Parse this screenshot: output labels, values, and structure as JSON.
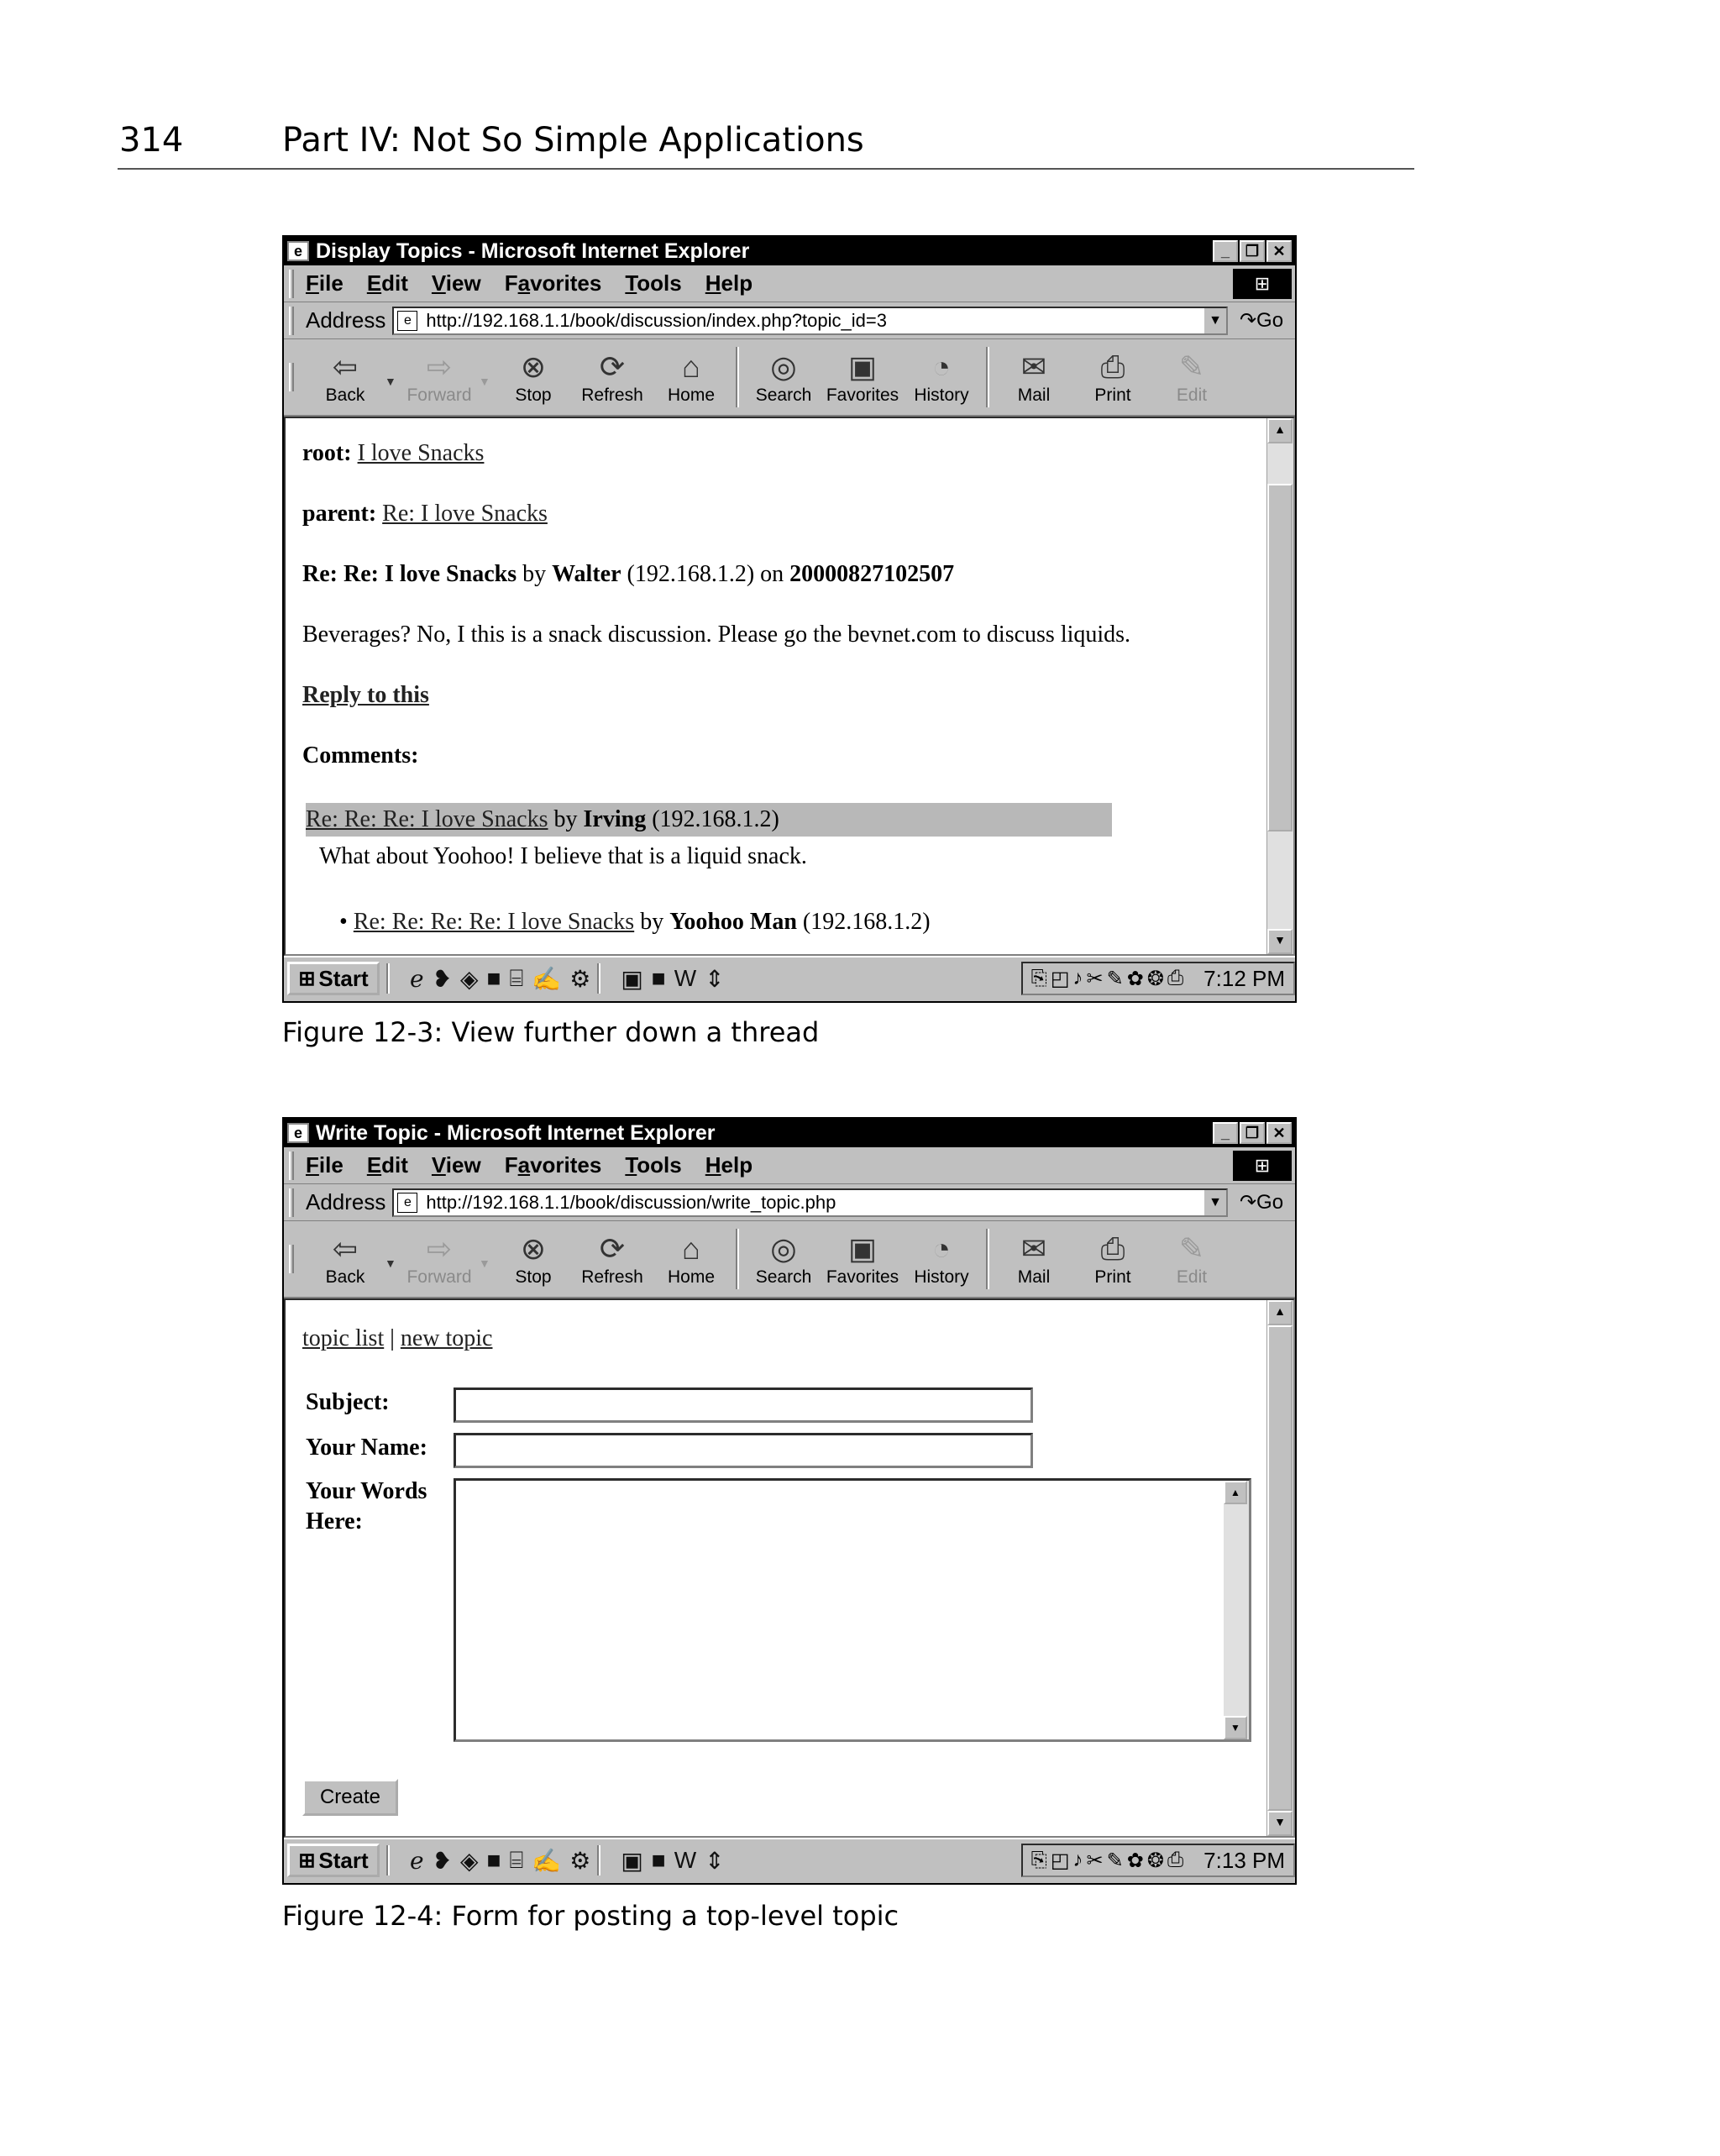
{
  "page": {
    "number": "314",
    "part": "Part IV: Not So Simple Applications"
  },
  "menu": [
    "File",
    "Edit",
    "View",
    "Favorites",
    "Tools",
    "Help"
  ],
  "menu_hotkeys": [
    "F",
    "E",
    "V",
    "a",
    "T",
    "H"
  ],
  "address_label": "Address",
  "go_label": "Go",
  "toolbar": {
    "back": "Back",
    "forward": "Forward",
    "stop": "Stop",
    "refresh": "Refresh",
    "home": "Home",
    "search": "Search",
    "favorites": "Favorites",
    "history": "History",
    "mail": "Mail",
    "print": "Print",
    "edit": "Edit"
  },
  "taskbar": {
    "start": "Start"
  },
  "window1": {
    "title": "Display Topics - Microsoft Internet Explorer",
    "url": "http://192.168.1.1/book/discussion/index.php?topic_id=3",
    "clock": "7:12 PM",
    "root_label": "root:",
    "root_link": "I love Snacks",
    "parent_label": "parent:",
    "parent_link": "Re: I love Snacks",
    "heading_title": "Re: Re: I love Snacks",
    "heading_by": "by",
    "heading_author": "Walter",
    "heading_ip": "(192.168.1.2)",
    "heading_on": "on",
    "heading_date": "20000827102507",
    "body": "Beverages? No, I this is a snack discussion. Please go the bevnet.com to discuss liquids.",
    "reply_link": "Reply to this",
    "comments_label": "Comments:",
    "comment1_link": "Re: Re: Re: I love Snacks",
    "comment1_by": "by",
    "comment1_author": "Irving",
    "comment1_ip": "(192.168.1.2)",
    "comment1_text": "What about Yoohoo! I believe that is a liquid snack.",
    "comment2_link": "Re: Re: Re: Re: I love Snacks",
    "comment2_by": "by",
    "comment2_author": "Yoohoo Man",
    "comment2_ip": "(192.168.1.2)",
    "caption": "Figure 12-3: View further down a thread"
  },
  "window2": {
    "title": "Write Topic - Microsoft Internet Explorer",
    "url": "http://192.168.1.1/book/discussion/write_topic.php",
    "clock": "7:13 PM",
    "topic_list_link": "topic list",
    "separator": "|",
    "new_topic_link": "new topic",
    "subject_label": "Subject:",
    "subject_value": "",
    "name_label": "Your Name:",
    "name_value": "",
    "words_label_1": "Your Words",
    "words_label_2": "Here:",
    "words_value": "",
    "create_button": "Create",
    "caption": "Figure 12-4: Form for posting a top-level topic"
  }
}
